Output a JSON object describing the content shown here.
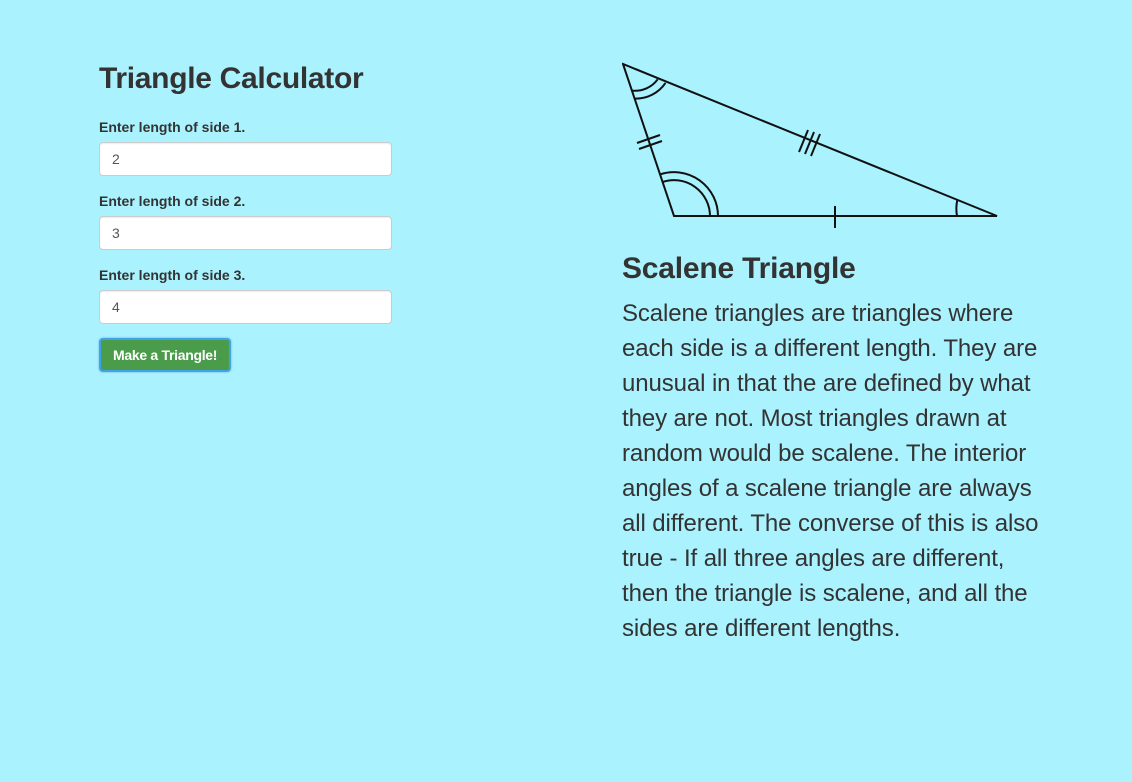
{
  "calculator": {
    "title": "Triangle Calculator",
    "fields": [
      {
        "label": "Enter length of side 1.",
        "value": "2"
      },
      {
        "label": "Enter length of side 2.",
        "value": "3"
      },
      {
        "label": "Enter length of side 3.",
        "value": "4"
      }
    ],
    "submit_label": "Make a Triangle!"
  },
  "result": {
    "diagram_icon": "scalene-triangle-diagram",
    "heading": "Scalene Triangle",
    "description": "Scalene triangles are triangles where each side is a different length. They are unusual in that the are defined by what they are not. Most triangles drawn at random would be scalene. The interior angles of a scalene triangle are always all different. The converse of this is also true - If all three angles are different, then the triangle is scalene, and all the sides are different lengths."
  },
  "colors": {
    "background": "#aaf2fd",
    "button": "#4a9c4a",
    "text": "#333333"
  }
}
